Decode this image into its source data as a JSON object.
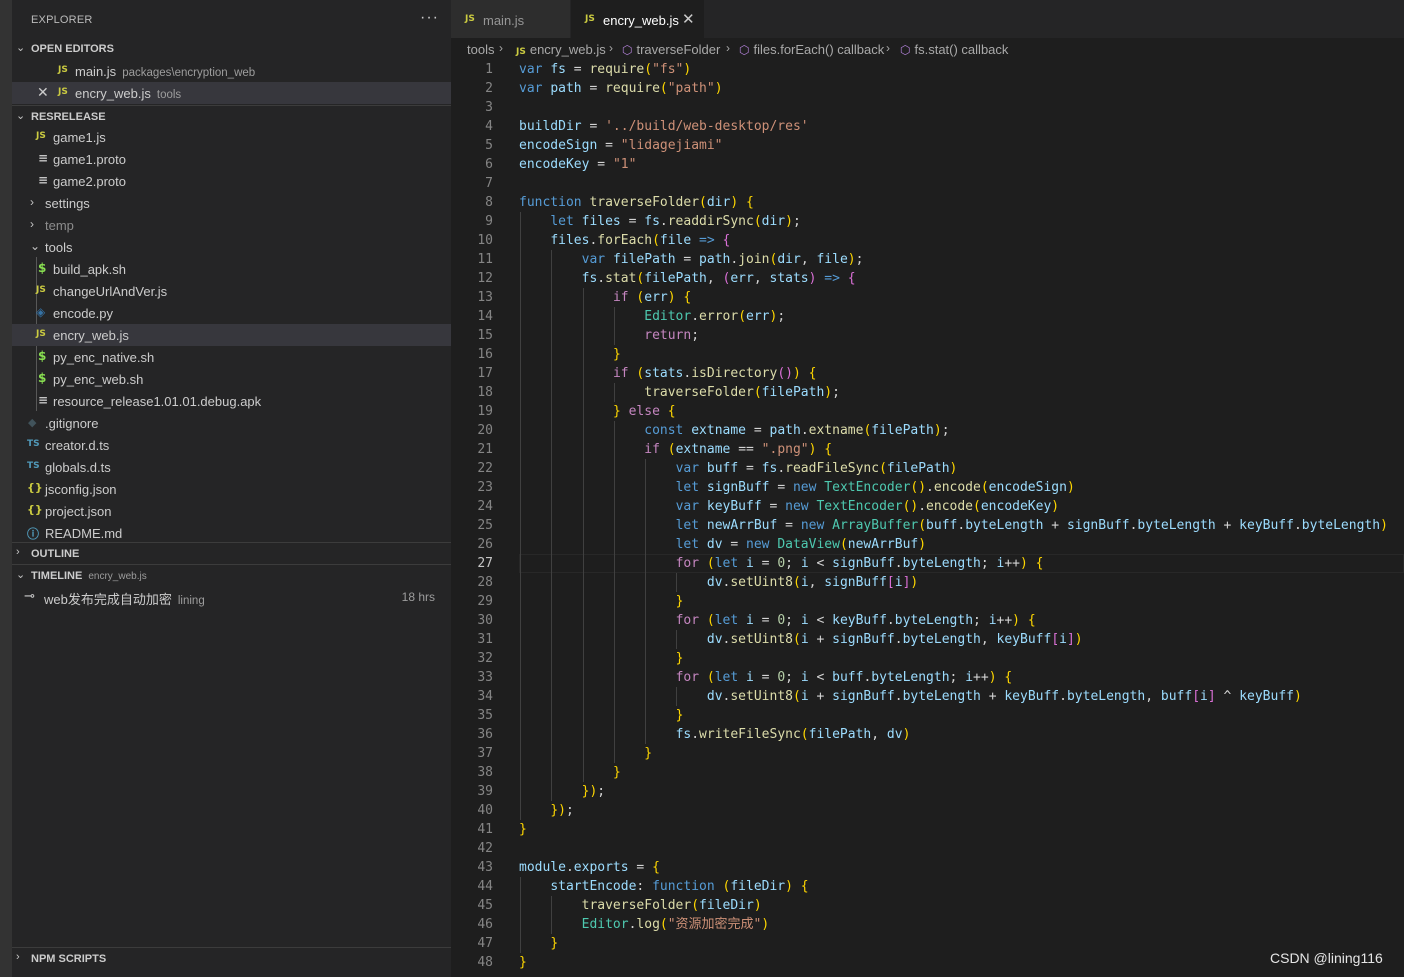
{
  "explorer": {
    "title": "EXPLORER",
    "more": "···",
    "open_editors": {
      "label": "OPEN EDITORS",
      "items": [
        {
          "icon": "JS",
          "name": "main.js",
          "desc": "packages\\encryption_web"
        },
        {
          "icon": "JS",
          "name": "encry_web.js",
          "desc": "tools"
        }
      ]
    },
    "folder": {
      "label": "RESRELEASE",
      "items": [
        {
          "icon": "JS",
          "name": "game1.js"
        },
        {
          "icon": "≡",
          "name": "game1.proto"
        },
        {
          "icon": "≡",
          "name": "game2.proto"
        },
        {
          "icon": ">",
          "name": "settings"
        },
        {
          "icon": ">",
          "name": "temp"
        },
        {
          "icon": "v",
          "name": "tools"
        },
        {
          "icon": "$",
          "name": "build_apk.sh"
        },
        {
          "icon": "JS",
          "name": "changeUrlAndVer.js"
        },
        {
          "icon": "py",
          "name": "encode.py"
        },
        {
          "icon": "JS",
          "name": "encry_web.js"
        },
        {
          "icon": "$",
          "name": "py_enc_native.sh"
        },
        {
          "icon": "$",
          "name": "py_enc_web.sh"
        },
        {
          "icon": "≡",
          "name": "resource_release1.01.01.debug.apk"
        },
        {
          "icon": "◆",
          "name": ".gitignore"
        },
        {
          "icon": "TS",
          "name": "creator.d.ts"
        },
        {
          "icon": "TS",
          "name": "globals.d.ts"
        },
        {
          "icon": "{}",
          "name": "jsconfig.json"
        },
        {
          "icon": "{}",
          "name": "project.json"
        },
        {
          "icon": "ⓘ",
          "name": "README.md"
        }
      ]
    },
    "outline": "OUTLINE",
    "timeline": {
      "label": "TIMELINE",
      "file": "encry_web.js",
      "entry": {
        "message": "web发布完成自动加密",
        "author": "lining",
        "time": "18 hrs"
      }
    },
    "npm_scripts": "NPM SCRIPTS"
  },
  "tabs": [
    {
      "icon": "JS",
      "label": "main.js"
    },
    {
      "icon": "JS",
      "label": "encry_web.js",
      "close": "✕"
    }
  ],
  "breadcrumbs": [
    "tools",
    "encry_web.js",
    "traverseFolder",
    "files.forEach() callback",
    "fs.stat() callback"
  ],
  "code": {
    "current_line": 27,
    "lines": [
      "var fs = require(\"fs\")",
      "var path = require(\"path\")",
      "",
      "buildDir = '../build/web-desktop/res'",
      "encodeSign = \"lidagejiami\"",
      "encodeKey = \"1\"",
      "",
      "function traverseFolder(dir) {",
      "    let files = fs.readdirSync(dir);",
      "    files.forEach(file => {",
      "        var filePath = path.join(dir, file);",
      "        fs.stat(filePath, (err, stats) => {",
      "            if (err) {",
      "                Editor.error(err);",
      "                return;",
      "            }",
      "            if (stats.isDirectory()) {",
      "                traverseFolder(filePath);",
      "            } else {",
      "                const extname = path.extname(filePath);",
      "                if (extname == \".png\") {",
      "                    var buff = fs.readFileSync(filePath)",
      "                    let signBuff = new TextEncoder().encode(encodeSign)",
      "                    var keyBuff = new TextEncoder().encode(encodeKey)",
      "                    let newArrBuf = new ArrayBuffer(buff.byteLength + signBuff.byteLength + keyBuff.byteLength)",
      "                    let dv = new DataView(newArrBuf)",
      "                    for (let i = 0; i < signBuff.byteLength; i++) {",
      "                        dv.setUint8(i, signBuff[i])",
      "                    }",
      "                    for (let i = 0; i < keyBuff.byteLength; i++) {",
      "                        dv.setUint8(i + signBuff.byteLength, keyBuff[i])",
      "                    }",
      "                    for (let i = 0; i < buff.byteLength; i++) {",
      "                        dv.setUint8(i + signBuff.byteLength + keyBuff.byteLength, buff[i] ^ keyBuff)",
      "                    }",
      "                    fs.writeFileSync(filePath, dv)",
      "                }",
      "            }",
      "        });",
      "    });",
      "}",
      "",
      "module.exports = {",
      "    startEncode: function (fileDir) {",
      "        traverseFolder(fileDir)",
      "        Editor.log(\"资源加密完成\")",
      "    }",
      "}"
    ]
  },
  "watermark": "CSDN @lining116"
}
